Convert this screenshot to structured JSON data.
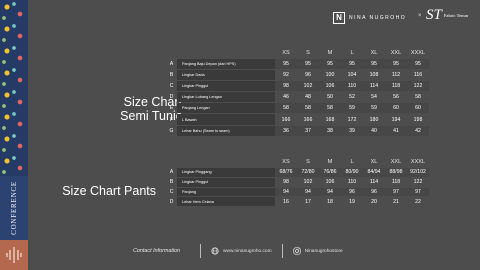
{
  "brand": {
    "nina_logo": "NINA NUGROHO",
    "nina_mark": "N",
    "times": "×",
    "fabric_glyph": "ST",
    "fabric_name": "Fabric Tenun"
  },
  "left_strip": {
    "vertical_text": "CONFERENCE"
  },
  "section1": {
    "title_line1": "Size Chart",
    "title_line2": "Semi Tunic",
    "sizes": [
      "XS",
      "S",
      "M",
      "L",
      "XL",
      "XXL",
      "XXXL"
    ],
    "rows": [
      {
        "key": "A",
        "label": "Panjang Baju Depan (dari HPS)",
        "values": [
          "95",
          "95",
          "95",
          "95",
          "95",
          "95",
          "95"
        ]
      },
      {
        "key": "B",
        "label": "Lingkar Dada",
        "values": [
          "92",
          "96",
          "100",
          "104",
          "108",
          "112",
          "116"
        ]
      },
      {
        "key": "C",
        "label": "Lingkar Pinggul",
        "values": [
          "98",
          "102",
          "106",
          "110",
          "114",
          "118",
          "122"
        ]
      },
      {
        "key": "D",
        "label": "Lingkar Lubang Lengan",
        "values": [
          "46",
          "48",
          "50",
          "52",
          "54",
          "56",
          "58"
        ]
      },
      {
        "key": "E",
        "label": "Panjang Lengan",
        "values": [
          "58",
          "58",
          "58",
          "59",
          "59",
          "60",
          "60"
        ]
      },
      {
        "key": "F",
        "label": "L Bawah",
        "values": [
          "166",
          "166",
          "168",
          "172",
          "180",
          "194",
          "198"
        ]
      },
      {
        "key": "G",
        "label": "Lebar Bahu (Seam to seam)",
        "values": [
          "36",
          "37",
          "38",
          "39",
          "40",
          "41",
          "42"
        ]
      }
    ]
  },
  "section2": {
    "title": "Size Chart Pants",
    "sizes": [
      "XS",
      "S",
      "M",
      "L",
      "XL",
      "XXL",
      "XXXL"
    ],
    "rows": [
      {
        "key": "A",
        "label": "Lingkar Pinggang",
        "values": [
          "68/76",
          "72/80",
          "76/86",
          "80/90",
          "84/94",
          "88/98",
          "92/102"
        ]
      },
      {
        "key": "B",
        "label": "Lingkar Pinggul",
        "values": [
          "98",
          "102",
          "106",
          "110",
          "114",
          "118",
          "122"
        ]
      },
      {
        "key": "C",
        "label": "Panjang",
        "values": [
          "94",
          "94",
          "94",
          "96",
          "96",
          "97",
          "97"
        ]
      },
      {
        "key": "D",
        "label": "Lebar Hem Celana",
        "values": [
          "16",
          "17",
          "18",
          "19",
          "20",
          "21",
          "22"
        ]
      }
    ]
  },
  "footer": {
    "contact_label": "Contact Information",
    "website": "www.ninanugroho.com",
    "instagram": "Ninanugrohostore",
    "web_icon": "globe-icon",
    "ig_icon": "instagram-icon"
  }
}
